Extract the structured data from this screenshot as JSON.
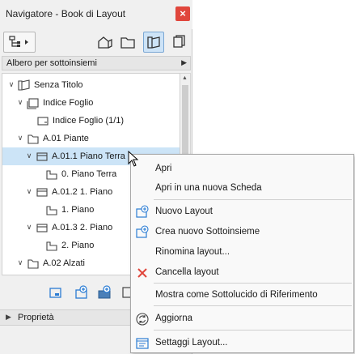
{
  "window": {
    "title": "Navigatore - Book di Layout",
    "close_glyph": "×"
  },
  "toolbar": {
    "buttons": [
      {
        "name": "sitemap-menu-icon"
      },
      {
        "name": "project-map-icon"
      },
      {
        "name": "view-map-icon"
      },
      {
        "name": "layout-book-icon",
        "active": true
      },
      {
        "name": "publisher-icon"
      }
    ]
  },
  "view_mode": {
    "label": "Albero per sottoinsiemi",
    "arrow": "▶"
  },
  "tree": {
    "rows": [
      {
        "label": "Senza Titolo",
        "chev": "∨",
        "icon": "book"
      },
      {
        "label": "Indice Foglio",
        "chev": "∨",
        "icon": "subset"
      },
      {
        "label": "Indice Foglio (1/1)",
        "chev": "",
        "icon": "sheet"
      },
      {
        "label": "A.01 Piante",
        "chev": "∨",
        "icon": "subset"
      },
      {
        "label": "A.01.1 Piano Terra",
        "chev": "∨",
        "icon": "subset",
        "selected": true
      },
      {
        "label": "0. Piano Terra",
        "chev": "",
        "icon": "layout"
      },
      {
        "label": "A.01.2 1. Piano",
        "chev": "∨",
        "icon": "subset"
      },
      {
        "label": "1. Piano",
        "chev": "",
        "icon": "layout"
      },
      {
        "label": "A.01.3 2. Piano",
        "chev": "∨",
        "icon": "subset"
      },
      {
        "label": "2. Piano",
        "chev": "",
        "icon": "layout"
      },
      {
        "label": "A.02 Alzati",
        "chev": "∨",
        "icon": "subset"
      }
    ]
  },
  "properties": {
    "label": "Proprietà",
    "arrow": "▶"
  },
  "context_menu": {
    "items": [
      {
        "label": "Apri",
        "icon": ""
      },
      {
        "label": "Apri in una nuova Scheda",
        "icon": ""
      },
      {
        "label": "Nuovo Layout",
        "icon": "new-layout-icon"
      },
      {
        "label": "Crea nuovo Sottoinsieme",
        "icon": "new-subset-icon"
      },
      {
        "label": "Rinomina layout...",
        "icon": ""
      },
      {
        "label": "Cancella layout",
        "icon": "delete-icon"
      },
      {
        "label": "Mostra come Sottolucido di Riferimento",
        "icon": ""
      },
      {
        "label": "Aggiorna",
        "icon": "refresh-icon"
      },
      {
        "label": "Settaggi Layout...",
        "icon": "settings-icon"
      }
    ]
  },
  "colors": {
    "selection": "#cce4f7",
    "close": "#e0463c",
    "delete": "#e0463c",
    "accent": "#2b7cd3"
  }
}
